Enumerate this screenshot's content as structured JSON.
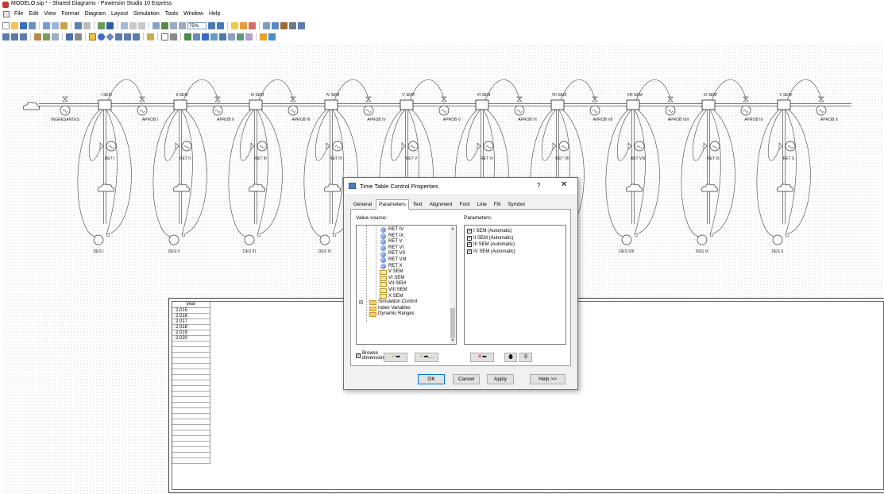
{
  "window": {
    "title": "MODELO.sip * - Shared Diagrams - Powersim Studio 10 Express"
  },
  "menu": [
    "File",
    "Edit",
    "View",
    "Format",
    "Diagram",
    "Layout",
    "Simulation",
    "Tools",
    "Window",
    "Help"
  ],
  "toolbar": {
    "zoom": "75%"
  },
  "diagram": {
    "source_label": "INGRESANTES",
    "stocks": [
      "I SEM",
      "II SEM",
      "III SEM",
      "IV SEM",
      "V SEM",
      "VI SEM",
      "VII SEM",
      "VIII SEM",
      "IX SEM",
      "X SEM"
    ],
    "approve_flows": [
      "APROB I",
      "APROB II",
      "APROB III",
      "APROB IV",
      "APROB V",
      "APROB VI",
      "APROB VII",
      "APROB VIII",
      "APROB IX",
      "APROB X"
    ],
    "retention_flows": [
      "RET I",
      "RET II",
      "RET III",
      "RET IV",
      "RET V",
      "RET VI",
      "RET VII",
      "RET VIII",
      "RET IX",
      "RET X"
    ],
    "dropouts": [
      "DES I",
      "DES II",
      "DES III",
      "DES IV",
      "DES V",
      "DES VI",
      "DES VII",
      "DES VIII",
      "DES IX",
      "DES X"
    ]
  },
  "time_table": {
    "header": "year",
    "years": [
      "2,015",
      "2,016",
      "2,017",
      "2,018",
      "2,019",
      "2,020"
    ]
  },
  "dialog": {
    "title": "Time Table Control Properties",
    "help_glyph": "?",
    "close_glyph": "✕",
    "tabs": [
      "General",
      "Parameters",
      "Text",
      "Alignment",
      "Font",
      "Line",
      "Fill",
      "Symbol"
    ],
    "active_tab": "Parameters",
    "value_source_label": "Value source:",
    "parameters_label": "Parameters:",
    "value_source_items": [
      {
        "label": "RET IV",
        "kind": "auxiliary"
      },
      {
        "label": "RET IX",
        "kind": "auxiliary"
      },
      {
        "label": "RET V",
        "kind": "auxiliary"
      },
      {
        "label": "RET VI",
        "kind": "auxiliary"
      },
      {
        "label": "RET VII",
        "kind": "auxiliary"
      },
      {
        "label": "RET VIII",
        "kind": "auxiliary"
      },
      {
        "label": "RET X",
        "kind": "auxiliary"
      },
      {
        "label": "V SEM",
        "kind": "level"
      },
      {
        "label": "VI SEM",
        "kind": "level"
      },
      {
        "label": "VII SEM",
        "kind": "level"
      },
      {
        "label": "VIII SEM",
        "kind": "level"
      },
      {
        "label": "X SEM",
        "kind": "level"
      },
      {
        "label": "Simulation Control",
        "kind": "folder-expandable"
      },
      {
        "label": "Index Variables",
        "kind": "folder"
      },
      {
        "label": "Dynamic Ranges",
        "kind": "folder"
      }
    ],
    "parameters": [
      "I SEM (Automatic)",
      "II SEM (Automatic)",
      "III SEM (Automatic)",
      "IV SEM (Automatic)"
    ],
    "browse_label_1": "Browse",
    "browse_label_2": "dimensions",
    "buttons": {
      "ok": "OK",
      "cancel": "Cancel",
      "apply": "Apply",
      "help": "Help >>"
    }
  }
}
